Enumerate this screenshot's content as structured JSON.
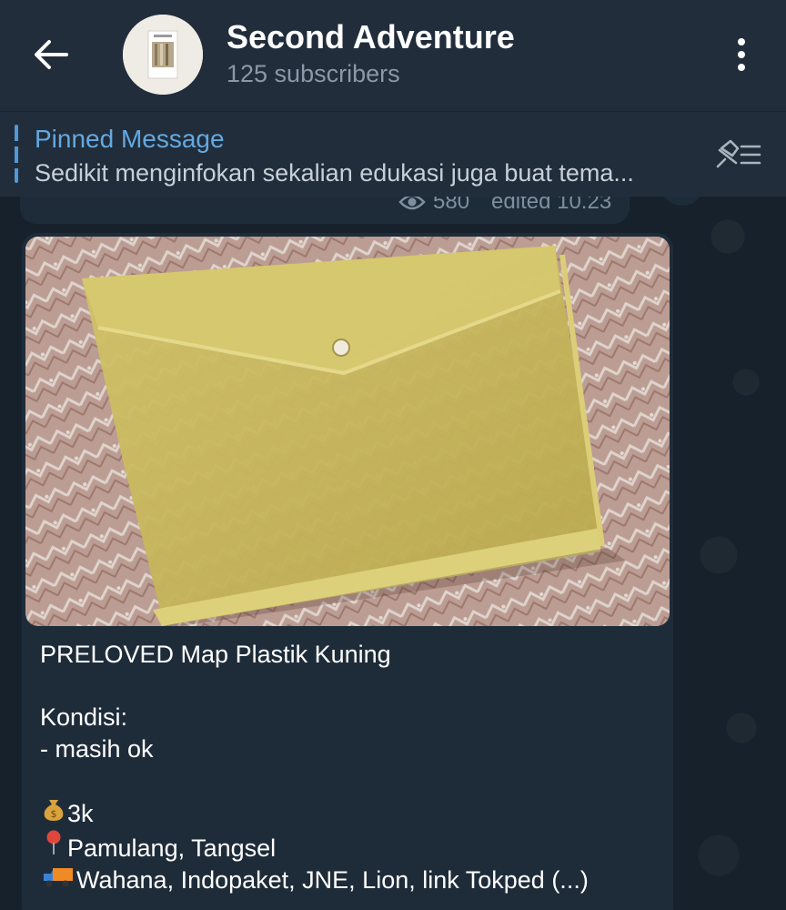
{
  "header": {
    "back_icon": "arrow-left-icon",
    "avatar_icon": "channel-avatar",
    "title": "Second Adventure",
    "subtitle": "125 subscribers",
    "menu_icon": "more-vertical-icon"
  },
  "pinned": {
    "title": "Pinned Message",
    "text": "Sedikit menginfokan sekalian edukasi juga buat tema...",
    "list_icon": "pinned-list-icon"
  },
  "previous_message": {
    "views": "580",
    "edited": "edited 10.23",
    "views_icon": "eye-icon"
  },
  "message": {
    "photo_icon": "product-photo",
    "title": "PRELOVED Map Plastik Kuning",
    "condition_label": "Kondisi:",
    "condition_value": "- masih ok",
    "price": "3k",
    "price_icon": "money-bag-icon",
    "location": "Pamulang, Tangsel",
    "location_icon": "pin-icon",
    "shipping": "Wahana, Indopaket, JNE, Lion, link Tokped (...)",
    "shipping_icon": "truck-icon"
  },
  "colors": {
    "header_bg": "#212d3b",
    "bubble_bg": "#1e2c3a",
    "accent": "#63a9e0",
    "muted": "#8a99a8"
  }
}
